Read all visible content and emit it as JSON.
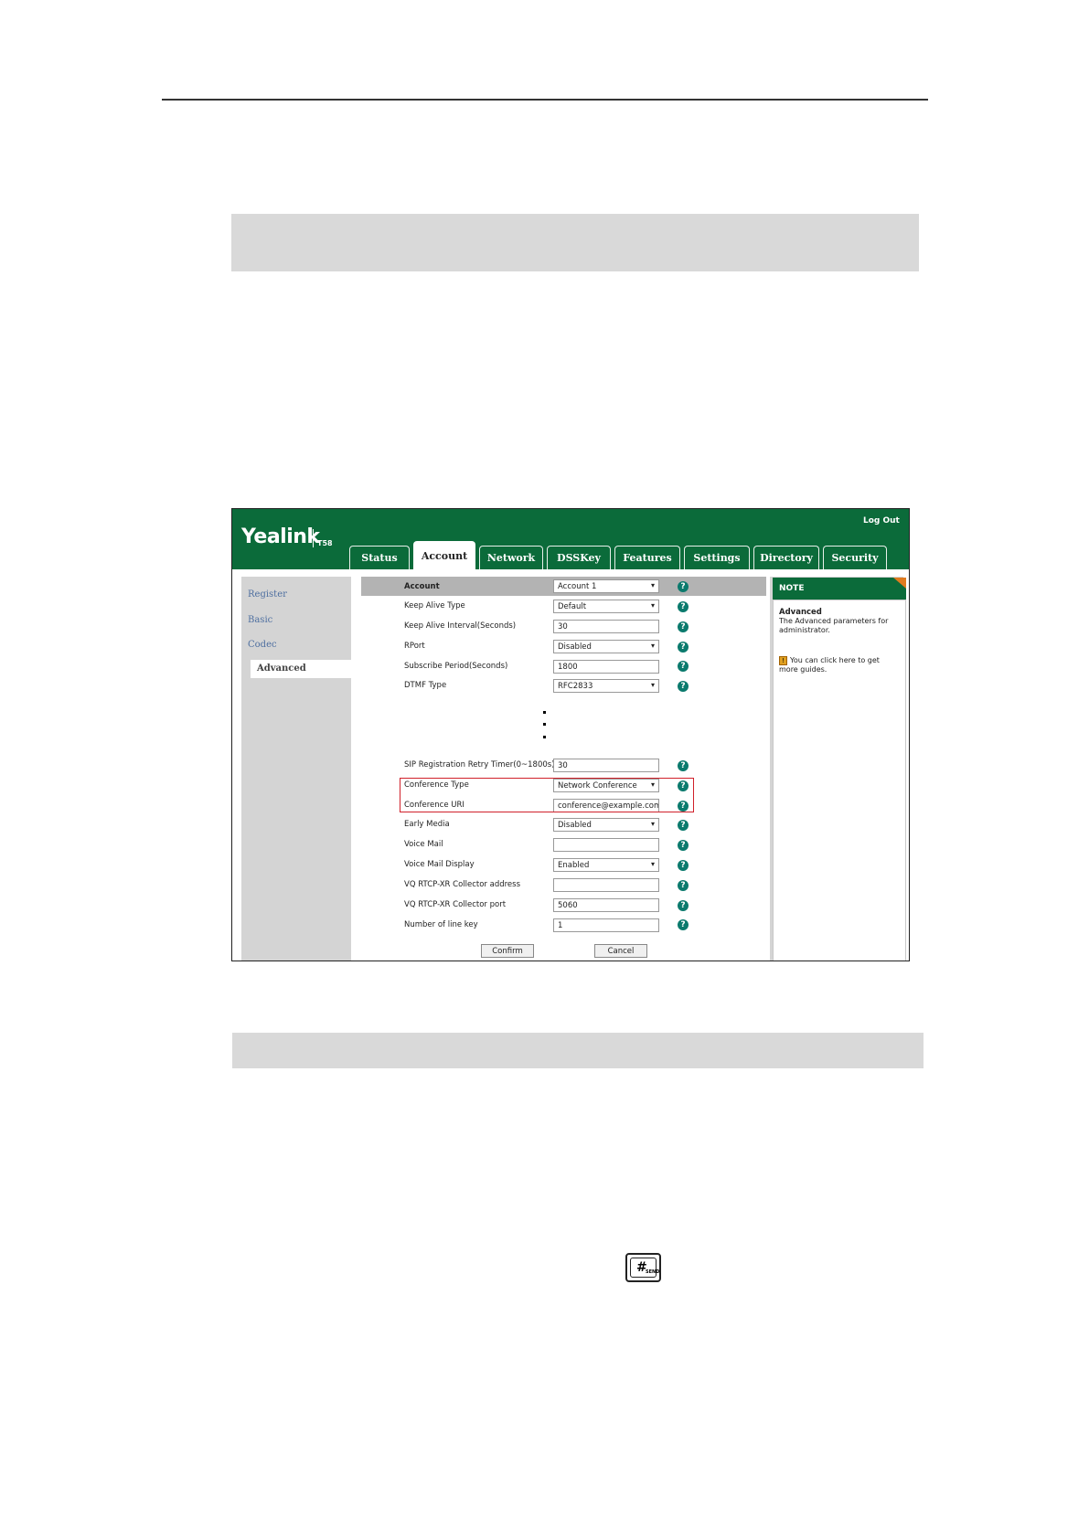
{
  "app": {
    "brand": "Yealink",
    "model": "T58",
    "logout": "Log Out"
  },
  "tabs": [
    {
      "label": "Status",
      "active": false
    },
    {
      "label": "Account",
      "active": true
    },
    {
      "label": "Network",
      "active": false
    },
    {
      "label": "DSSKey",
      "active": false
    },
    {
      "label": "Features",
      "active": false
    },
    {
      "label": "Settings",
      "active": false
    },
    {
      "label": "Directory",
      "active": false
    },
    {
      "label": "Security",
      "active": false
    }
  ],
  "sidebar": {
    "items": [
      {
        "label": "Register"
      },
      {
        "label": "Basic"
      },
      {
        "label": "Codec"
      },
      {
        "label": "Advanced",
        "active": true
      }
    ]
  },
  "form": {
    "rows": [
      {
        "label": "Account",
        "value": "Account 1",
        "type": "select"
      },
      {
        "label": "Keep Alive Type",
        "value": "Default",
        "type": "select"
      },
      {
        "label": "Keep Alive Interval(Seconds)",
        "value": "30",
        "type": "input"
      },
      {
        "label": "RPort",
        "value": "Disabled",
        "type": "select"
      },
      {
        "label": "Subscribe Period(Seconds)",
        "value": "1800",
        "type": "input"
      },
      {
        "label": "DTMF Type",
        "value": "RFC2833",
        "type": "select"
      },
      {
        "label": "SIP Registration Retry Timer(0~1800s)",
        "value": "30",
        "type": "input"
      },
      {
        "label": "Conference Type",
        "value": "Network Conference",
        "type": "select"
      },
      {
        "label": "Conference URI",
        "value": "conference@example.com",
        "type": "input"
      },
      {
        "label": "Early Media",
        "value": "Disabled",
        "type": "select"
      },
      {
        "label": "Voice Mail",
        "value": "",
        "type": "input"
      },
      {
        "label": "Voice Mail Display",
        "value": "Enabled",
        "type": "select"
      },
      {
        "label": "VQ RTCP-XR Collector address",
        "value": "",
        "type": "input"
      },
      {
        "label": "VQ RTCP-XR Collector port",
        "value": "5060",
        "type": "input"
      },
      {
        "label": "Number of line key",
        "value": "1",
        "type": "input"
      }
    ],
    "confirm": "Confirm",
    "cancel": "Cancel"
  },
  "note": {
    "header": "NOTE",
    "title": "Advanced",
    "text": "The Advanced parameters for administrator.",
    "link_text": "You can click here to get more guides."
  },
  "key": {
    "symbol": "#",
    "sub": "SEND"
  },
  "colors": {
    "brand_green": "#0b6b3a",
    "help_teal": "#0b7a6d",
    "highlight_red": "#d0202a"
  }
}
